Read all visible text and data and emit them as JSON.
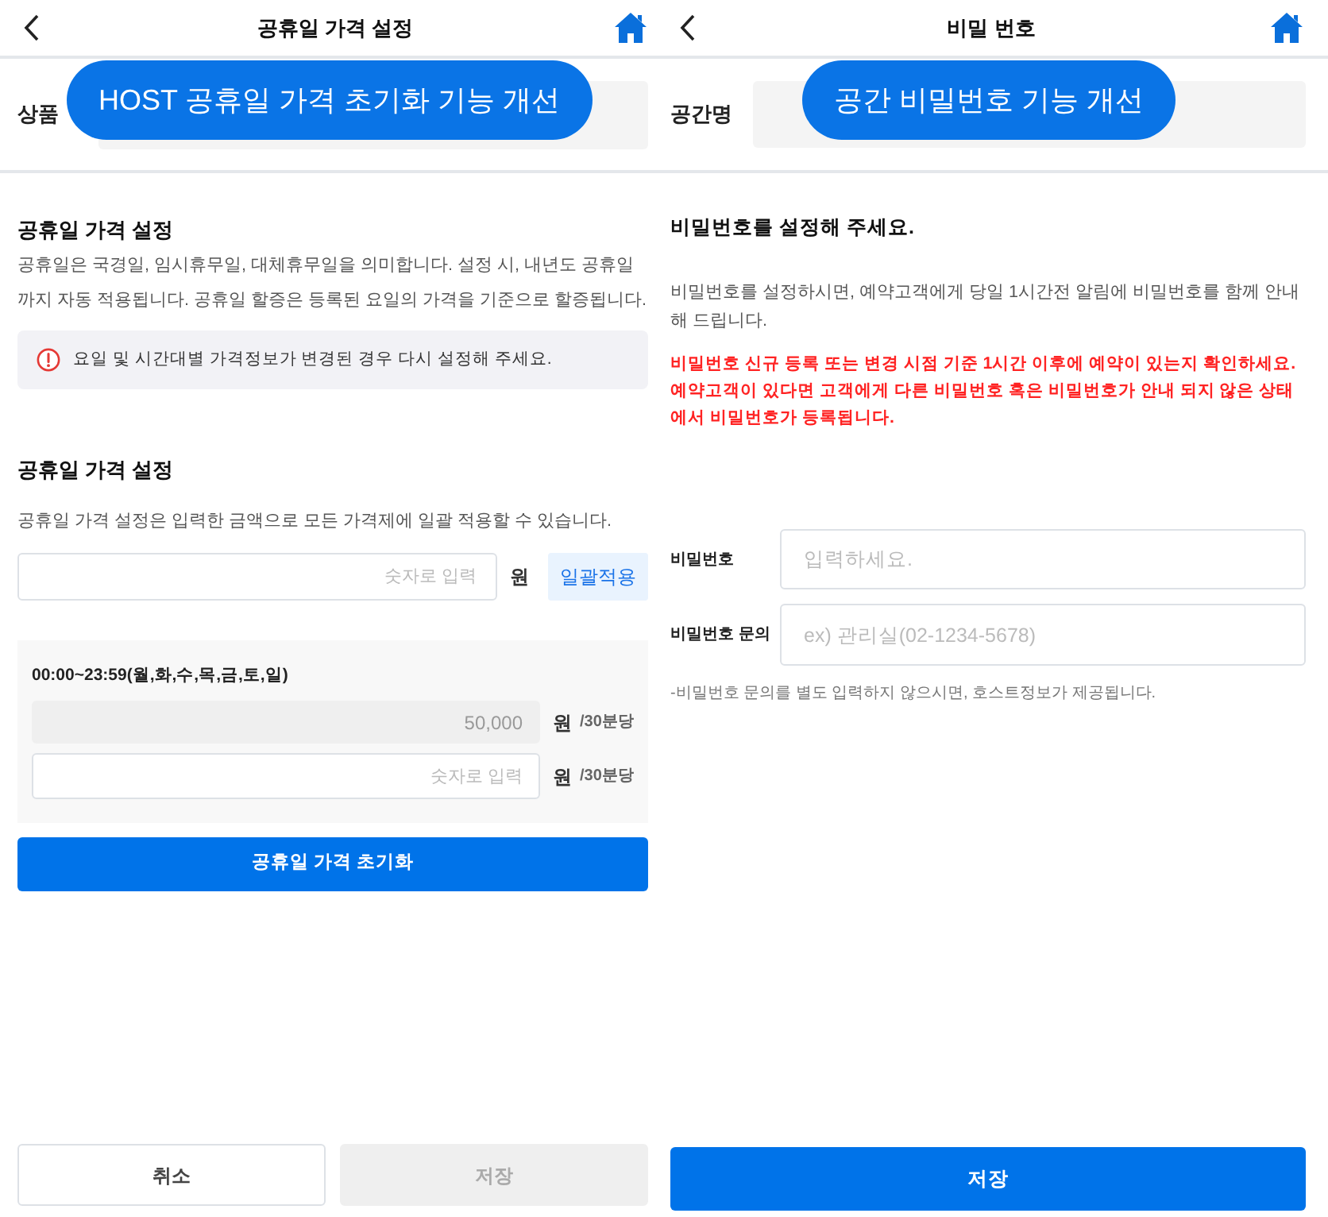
{
  "left_screen": {
    "header": {
      "title": "공휴일 가격 설정"
    },
    "name_row": {
      "label": "상품",
      "callout": "HOST 공휴일 가격 초기화 기능 개선"
    },
    "info_section": {
      "heading": "공휴일 가격 설정",
      "description": "공휴일은 국경일, 임시휴무일, 대체휴무일을 의미합니다. 설정 시, 내년도 공휴일까지 자동 적용됩니다. 공휴일 할증은 등록된 요일의 가격을 기준으로 할증됩니다.",
      "alert": "요일 및 시간대별 가격정보가 변경된 경우 다시 설정해 주세요."
    },
    "bulk_section": {
      "heading": "공휴일 가격 설정",
      "description": "공휴일 가격 설정은 입력한 금액으로 모든 가격제에 일괄 적용할 수 있습니다.",
      "input": {
        "placeholder": "숫자로 입력"
      },
      "unit": "원",
      "apply_button": "일괄적용"
    },
    "time_slot": {
      "label": "00:00~23:59(월,화,수,목,금,토,일)",
      "rows": [
        {
          "value": "50,000",
          "disabled": true,
          "unit": "원",
          "per": "/30분당"
        },
        {
          "placeholder": "숫자로 입력",
          "disabled": false,
          "unit": "원",
          "per": "/30분당"
        }
      ]
    },
    "reset_button": "공휴일 가격 초기화",
    "footer_buttons": [
      {
        "label": "취소",
        "disabled": false
      },
      {
        "label": "저장",
        "disabled": true
      }
    ]
  },
  "right_screen": {
    "header": {
      "title": "비밀 번호"
    },
    "name_row": {
      "label": "공간명",
      "callout": "공간 비밀번호 기능 개선"
    },
    "heading": "비밀번호를 설정해 주세요.",
    "description": "비밀번호를 설정하시면, 예약고객에게 당일 1시간전 알림에 비밀번호를 함께 안내해 드립니다.",
    "warning": "비밀번호 신규 등록 또는 변경 시점 기준 1시간 이후에 예약이 있는지 확인하세요. 예약고객이 있다면 고객에게 다른 비밀번호 혹은 비밀번호가 안내 되지 않은 상태에서 비밀번호가 등록됩니다.",
    "fields": [
      {
        "label": "비밀번호",
        "placeholder": "입력하세요."
      },
      {
        "label": "비밀번호 문의",
        "placeholder": "ex) 관리실(02-1234-5678)"
      }
    ],
    "note": "-비밀번호 문의를 별도 입력하지 않으시면, 호스트정보가 제공됩니다.",
    "save_button": {
      "label": "저장",
      "disabled": false
    }
  }
}
